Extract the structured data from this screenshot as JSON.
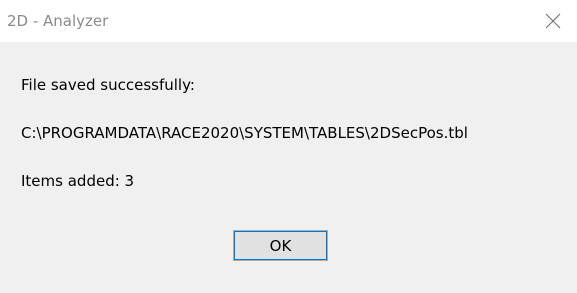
{
  "window": {
    "title": "2D - Analyzer",
    "close_icon": "close-icon"
  },
  "message": {
    "line1": "File saved successfully:",
    "line2": "C:\\PROGRAMDATA\\RACE2020\\SYSTEM\\TABLES\\2DSecPos.tbl",
    "line3": "Items added: 3"
  },
  "buttons": {
    "ok_label": "OK"
  },
  "colors": {
    "title_text": "#8a8a8a",
    "dialog_background": "#f0f0f0",
    "button_focus": "#0078d7"
  }
}
